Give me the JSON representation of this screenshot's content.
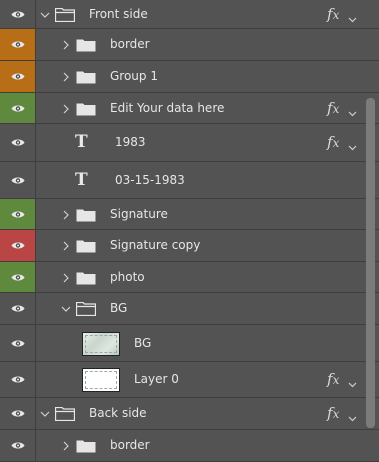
{
  "layers": [
    {
      "name": "Front side",
      "type": "group",
      "expanded": true,
      "indent": 0,
      "tag": "none",
      "fx": true
    },
    {
      "name": "border",
      "type": "group",
      "expanded": false,
      "indent": 1,
      "tag": "orange",
      "fx": false
    },
    {
      "name": "Group 1",
      "type": "group",
      "expanded": false,
      "indent": 1,
      "tag": "orange",
      "fx": false
    },
    {
      "name": "Edit Your data here",
      "type": "group",
      "expanded": false,
      "indent": 1,
      "tag": "green",
      "fx": true
    },
    {
      "name": "1983",
      "type": "text",
      "indent": 1,
      "tag": "none",
      "fx": true
    },
    {
      "name": "03-15-1983",
      "type": "text",
      "indent": 1,
      "tag": "none",
      "fx": false
    },
    {
      "name": "Signature",
      "type": "group",
      "expanded": false,
      "indent": 1,
      "tag": "green",
      "fx": false
    },
    {
      "name": "Signature copy",
      "type": "group",
      "expanded": false,
      "indent": 1,
      "tag": "red",
      "fx": false
    },
    {
      "name": "photo",
      "type": "group",
      "expanded": false,
      "indent": 1,
      "tag": "green",
      "fx": false
    },
    {
      "name": "BG",
      "type": "group",
      "expanded": true,
      "indent": 1,
      "tag": "none",
      "fx": false
    },
    {
      "name": "BG",
      "type": "pixel",
      "thumb": "bg-image",
      "indent": 2,
      "tag": "none",
      "fx": false
    },
    {
      "name": "Layer 0",
      "type": "pixel",
      "thumb": "white-dashed",
      "indent": 2,
      "tag": "none",
      "fx": true
    },
    {
      "name": "Back side",
      "type": "group",
      "expanded": true,
      "indent": 0,
      "tag": "none",
      "fx": true
    },
    {
      "name": "border",
      "type": "group",
      "expanded": false,
      "indent": 1,
      "tag": "none",
      "fx": false
    }
  ],
  "colors": {
    "panel_bg": "#535353",
    "tag_orange": "#b86d17",
    "tag_green": "#5f8a3d",
    "tag_red": "#b94545"
  },
  "icons": {
    "visibility": "eye-icon",
    "fx": "fx-icon",
    "expand": "chevron-right-icon",
    "collapse": "chevron-down-icon",
    "folder": "folder-icon",
    "text": "text-layer-icon"
  }
}
